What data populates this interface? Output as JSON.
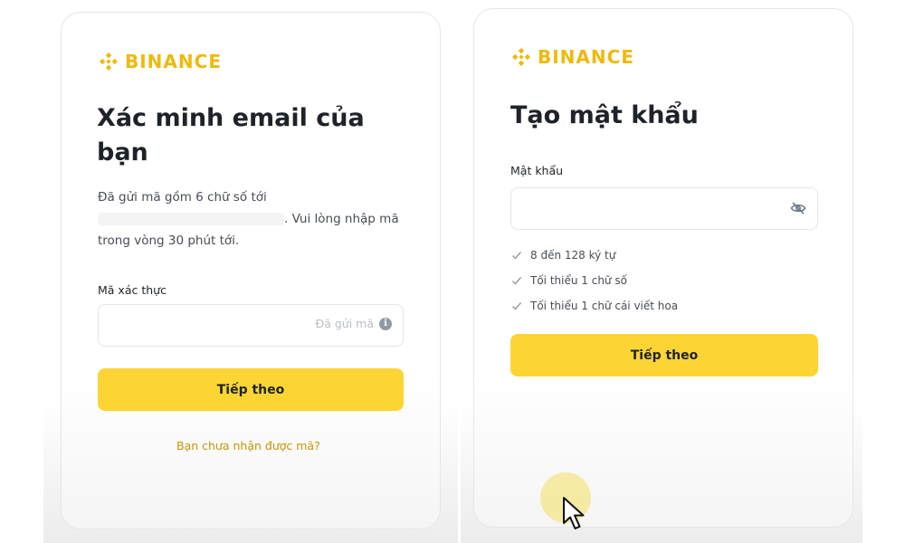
{
  "brand": {
    "name": "BINANCE",
    "color": "#F0B90B"
  },
  "verify_email": {
    "title": "Xác minh email của bạn",
    "desc_line1": "Đã gửi mã gồm 6 chữ số tới",
    "desc_line2_suffix": ". Vui lòng nhập mã",
    "desc_line3": "trong vòng 30 phút tới.",
    "code_label": "Mã xác thực",
    "code_value": "",
    "sent_label": "Đã gửi mã",
    "next_button": "Tiếp theo",
    "resend_link": "Bạn chưa nhận được mã?"
  },
  "create_password": {
    "title": "Tạo mật khẩu",
    "password_label": "Mật khẩu",
    "password_value": "",
    "rules": [
      {
        "text": "8 đến 128 ký tự"
      },
      {
        "text": "Tối thiểu 1 chữ số"
      },
      {
        "text": "Tối thiểu 1 chữ cái viết hoa"
      }
    ],
    "next_button": "Tiếp theo"
  },
  "colors": {
    "accent": "#FCD535",
    "link": "#C99400",
    "text": "#1E2329"
  },
  "icons": [
    "binance-logo-icon",
    "info-icon",
    "eye-slash-icon",
    "check-icon",
    "mouse-cursor-icon"
  ]
}
